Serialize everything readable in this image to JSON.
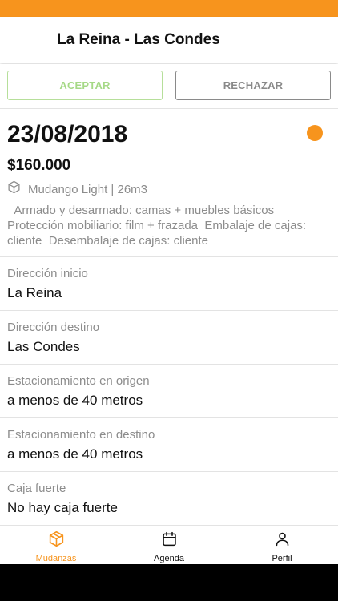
{
  "colors": {
    "accent": "#f7941d",
    "accept_border": "#b6df9a",
    "reject_border": "#8a8a8a",
    "status_dot": "#f7941d"
  },
  "header": {
    "title": "La Reina - Las Condes"
  },
  "actions": {
    "accept_label": "ACEPTAR",
    "reject_label": "RECHAZAR"
  },
  "summary": {
    "date": "23/08/2018",
    "price": "$160.000",
    "service_icon": "box-icon",
    "service": "Mudango Light | 26m3",
    "details": "  Armado y desarmado: camas + muebles básicos Protección mobiliario: film + frazada  Embalaje de cajas: cliente  Desembalaje de cajas: cliente"
  },
  "info": [
    {
      "label": "Dirección inicio",
      "value": "La Reina"
    },
    {
      "label": "Dirección destino",
      "value": "Las Condes"
    },
    {
      "label": "Estacionamiento en origen",
      "value": "a menos de 40 metros"
    },
    {
      "label": "Estacionamiento en destino",
      "value": "a menos de 40 metros"
    },
    {
      "label": "Caja fuerte",
      "value": "No hay caja fuerte"
    }
  ],
  "tabs": [
    {
      "label": "Mudanzas",
      "icon": "box-icon",
      "active": true
    },
    {
      "label": "Agenda",
      "icon": "calendar-icon",
      "active": false
    },
    {
      "label": "Perfil",
      "icon": "user-icon",
      "active": false
    }
  ]
}
